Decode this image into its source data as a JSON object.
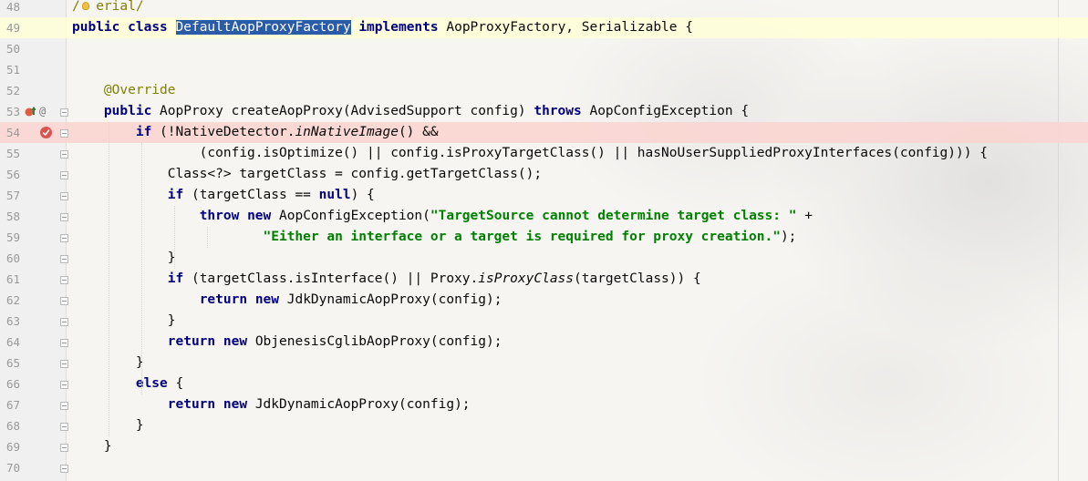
{
  "editor": {
    "lines": [
      {
        "n": "48",
        "tokens": [
          {
            "t": "/",
            "c": "ann"
          },
          {
            "t": "  erial/",
            "c": "ann"
          }
        ]
      },
      {
        "n": "49",
        "tokens": [
          {
            "t": "public",
            "c": "kw"
          },
          {
            "t": " "
          },
          {
            "t": "class",
            "c": "kw"
          },
          {
            "t": " "
          },
          {
            "t": "DefaultAopProxyFactory",
            "c": "sel"
          },
          {
            "t": " "
          },
          {
            "t": "implements",
            "c": "kw"
          },
          {
            "t": " AopProxyFactory, Serializable {"
          }
        ]
      },
      {
        "n": "50",
        "tokens": []
      },
      {
        "n": "51",
        "tokens": []
      },
      {
        "n": "52",
        "tokens": [
          {
            "t": "    "
          },
          {
            "t": "@Override",
            "c": "ann"
          }
        ]
      },
      {
        "n": "53",
        "tokens": [
          {
            "t": "    "
          },
          {
            "t": "public",
            "c": "kw"
          },
          {
            "t": " AopProxy createAopProxy(AdvisedSupport config) "
          },
          {
            "t": "throws",
            "c": "kw"
          },
          {
            "t": " AopConfigException {"
          }
        ]
      },
      {
        "n": "54",
        "tokens": [
          {
            "t": "        "
          },
          {
            "t": "if",
            "c": "kw"
          },
          {
            "t": " (!NativeDetector."
          },
          {
            "t": "inNativeImage",
            "c": "it"
          },
          {
            "t": "() &&"
          }
        ]
      },
      {
        "n": "55",
        "tokens": [
          {
            "t": "                (config.isOptimize() || config.isProxyTargetClass() || hasNoUserSuppliedProxyInterfaces(config))) {"
          }
        ]
      },
      {
        "n": "56",
        "tokens": [
          {
            "t": "            Class<?> targetClass = config.getTargetClass();"
          }
        ]
      },
      {
        "n": "57",
        "tokens": [
          {
            "t": "            "
          },
          {
            "t": "if",
            "c": "kw"
          },
          {
            "t": " (targetClass == "
          },
          {
            "t": "null",
            "c": "kw"
          },
          {
            "t": ") {"
          }
        ]
      },
      {
        "n": "58",
        "tokens": [
          {
            "t": "                "
          },
          {
            "t": "throw",
            "c": "kw"
          },
          {
            "t": " "
          },
          {
            "t": "new",
            "c": "kw"
          },
          {
            "t": " AopConfigException("
          },
          {
            "t": "\"TargetSource cannot determine target class: \"",
            "c": "str"
          },
          {
            "t": " +"
          }
        ]
      },
      {
        "n": "59",
        "tokens": [
          {
            "t": "                        "
          },
          {
            "t": "\"Either an interface or a target is required for proxy creation.\"",
            "c": "str"
          },
          {
            "t": ");"
          }
        ]
      },
      {
        "n": "60",
        "tokens": [
          {
            "t": "            }"
          }
        ]
      },
      {
        "n": "61",
        "tokens": [
          {
            "t": "            "
          },
          {
            "t": "if",
            "c": "kw"
          },
          {
            "t": " (targetClass.isInterface() || Proxy."
          },
          {
            "t": "isProxyClass",
            "c": "it"
          },
          {
            "t": "(targetClass)) {"
          }
        ]
      },
      {
        "n": "62",
        "tokens": [
          {
            "t": "                "
          },
          {
            "t": "return",
            "c": "kw"
          },
          {
            "t": " "
          },
          {
            "t": "new",
            "c": "kw"
          },
          {
            "t": " JdkDynamicAopProxy(config);"
          }
        ]
      },
      {
        "n": "63",
        "tokens": [
          {
            "t": "            }"
          }
        ]
      },
      {
        "n": "64",
        "tokens": [
          {
            "t": "            "
          },
          {
            "t": "return",
            "c": "kw"
          },
          {
            "t": " "
          },
          {
            "t": "new",
            "c": "kw"
          },
          {
            "t": " ObjenesisCglibAopProxy(config);"
          }
        ]
      },
      {
        "n": "65",
        "tokens": [
          {
            "t": "        }"
          }
        ]
      },
      {
        "n": "66",
        "tokens": [
          {
            "t": "        "
          },
          {
            "t": "else",
            "c": "kw"
          },
          {
            "t": " {"
          }
        ]
      },
      {
        "n": "67",
        "tokens": [
          {
            "t": "            "
          },
          {
            "t": "return",
            "c": "kw"
          },
          {
            "t": " "
          },
          {
            "t": "new",
            "c": "kw"
          },
          {
            "t": " JdkDynamicAopProxy(config);"
          }
        ]
      },
      {
        "n": "68",
        "tokens": [
          {
            "t": "        }"
          }
        ]
      },
      {
        "n": "69",
        "tokens": [
          {
            "t": "    }"
          }
        ]
      },
      {
        "n": "70",
        "tokens": []
      }
    ],
    "current_line": "49",
    "breakpoint_line": "54",
    "gutter_icons": {
      "override_icon": "override-method-icon",
      "annotation_icon": "@",
      "breakpoint_icon": "breakpoint-icon",
      "intention_icon": "lightbulb-icon"
    },
    "colors": {
      "selection": "#2a5ba8",
      "keyword": "#000080",
      "string": "#008000",
      "annotation": "#808000",
      "breakpoint_line": "#fad4d0",
      "current_line": "#ffffd7"
    }
  }
}
